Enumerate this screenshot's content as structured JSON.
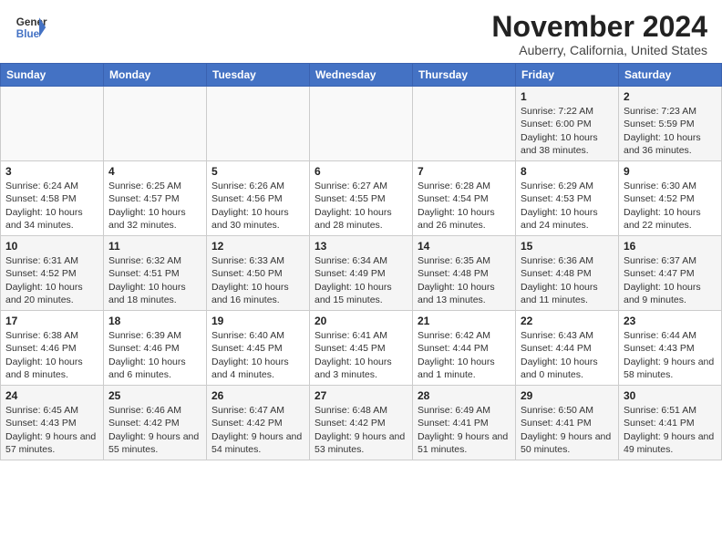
{
  "header": {
    "logo_line1": "General",
    "logo_line2": "Blue",
    "month_title": "November 2024",
    "location": "Auberry, California, United States"
  },
  "weekdays": [
    "Sunday",
    "Monday",
    "Tuesday",
    "Wednesday",
    "Thursday",
    "Friday",
    "Saturday"
  ],
  "weeks": [
    [
      {
        "day": "",
        "info": ""
      },
      {
        "day": "",
        "info": ""
      },
      {
        "day": "",
        "info": ""
      },
      {
        "day": "",
        "info": ""
      },
      {
        "day": "",
        "info": ""
      },
      {
        "day": "1",
        "info": "Sunrise: 7:22 AM\nSunset: 6:00 PM\nDaylight: 10 hours and 38 minutes."
      },
      {
        "day": "2",
        "info": "Sunrise: 7:23 AM\nSunset: 5:59 PM\nDaylight: 10 hours and 36 minutes."
      }
    ],
    [
      {
        "day": "3",
        "info": "Sunrise: 6:24 AM\nSunset: 4:58 PM\nDaylight: 10 hours and 34 minutes."
      },
      {
        "day": "4",
        "info": "Sunrise: 6:25 AM\nSunset: 4:57 PM\nDaylight: 10 hours and 32 minutes."
      },
      {
        "day": "5",
        "info": "Sunrise: 6:26 AM\nSunset: 4:56 PM\nDaylight: 10 hours and 30 minutes."
      },
      {
        "day": "6",
        "info": "Sunrise: 6:27 AM\nSunset: 4:55 PM\nDaylight: 10 hours and 28 minutes."
      },
      {
        "day": "7",
        "info": "Sunrise: 6:28 AM\nSunset: 4:54 PM\nDaylight: 10 hours and 26 minutes."
      },
      {
        "day": "8",
        "info": "Sunrise: 6:29 AM\nSunset: 4:53 PM\nDaylight: 10 hours and 24 minutes."
      },
      {
        "day": "9",
        "info": "Sunrise: 6:30 AM\nSunset: 4:52 PM\nDaylight: 10 hours and 22 minutes."
      }
    ],
    [
      {
        "day": "10",
        "info": "Sunrise: 6:31 AM\nSunset: 4:52 PM\nDaylight: 10 hours and 20 minutes."
      },
      {
        "day": "11",
        "info": "Sunrise: 6:32 AM\nSunset: 4:51 PM\nDaylight: 10 hours and 18 minutes."
      },
      {
        "day": "12",
        "info": "Sunrise: 6:33 AM\nSunset: 4:50 PM\nDaylight: 10 hours and 16 minutes."
      },
      {
        "day": "13",
        "info": "Sunrise: 6:34 AM\nSunset: 4:49 PM\nDaylight: 10 hours and 15 minutes."
      },
      {
        "day": "14",
        "info": "Sunrise: 6:35 AM\nSunset: 4:48 PM\nDaylight: 10 hours and 13 minutes."
      },
      {
        "day": "15",
        "info": "Sunrise: 6:36 AM\nSunset: 4:48 PM\nDaylight: 10 hours and 11 minutes."
      },
      {
        "day": "16",
        "info": "Sunrise: 6:37 AM\nSunset: 4:47 PM\nDaylight: 10 hours and 9 minutes."
      }
    ],
    [
      {
        "day": "17",
        "info": "Sunrise: 6:38 AM\nSunset: 4:46 PM\nDaylight: 10 hours and 8 minutes."
      },
      {
        "day": "18",
        "info": "Sunrise: 6:39 AM\nSunset: 4:46 PM\nDaylight: 10 hours and 6 minutes."
      },
      {
        "day": "19",
        "info": "Sunrise: 6:40 AM\nSunset: 4:45 PM\nDaylight: 10 hours and 4 minutes."
      },
      {
        "day": "20",
        "info": "Sunrise: 6:41 AM\nSunset: 4:45 PM\nDaylight: 10 hours and 3 minutes."
      },
      {
        "day": "21",
        "info": "Sunrise: 6:42 AM\nSunset: 4:44 PM\nDaylight: 10 hours and 1 minute."
      },
      {
        "day": "22",
        "info": "Sunrise: 6:43 AM\nSunset: 4:44 PM\nDaylight: 10 hours and 0 minutes."
      },
      {
        "day": "23",
        "info": "Sunrise: 6:44 AM\nSunset: 4:43 PM\nDaylight: 9 hours and 58 minutes."
      }
    ],
    [
      {
        "day": "24",
        "info": "Sunrise: 6:45 AM\nSunset: 4:43 PM\nDaylight: 9 hours and 57 minutes."
      },
      {
        "day": "25",
        "info": "Sunrise: 6:46 AM\nSunset: 4:42 PM\nDaylight: 9 hours and 55 minutes."
      },
      {
        "day": "26",
        "info": "Sunrise: 6:47 AM\nSunset: 4:42 PM\nDaylight: 9 hours and 54 minutes."
      },
      {
        "day": "27",
        "info": "Sunrise: 6:48 AM\nSunset: 4:42 PM\nDaylight: 9 hours and 53 minutes."
      },
      {
        "day": "28",
        "info": "Sunrise: 6:49 AM\nSunset: 4:41 PM\nDaylight: 9 hours and 51 minutes."
      },
      {
        "day": "29",
        "info": "Sunrise: 6:50 AM\nSunset: 4:41 PM\nDaylight: 9 hours and 50 minutes."
      },
      {
        "day": "30",
        "info": "Sunrise: 6:51 AM\nSunset: 4:41 PM\nDaylight: 9 hours and 49 minutes."
      }
    ]
  ]
}
